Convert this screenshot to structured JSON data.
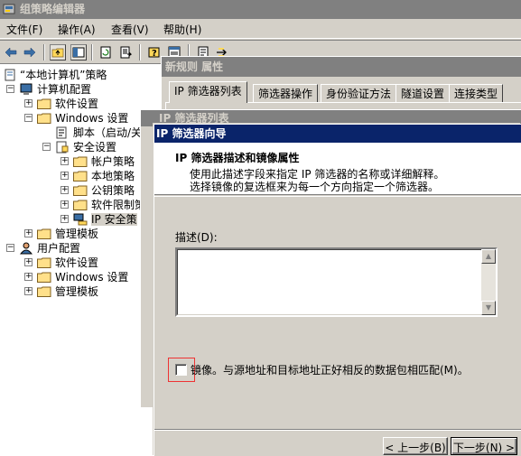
{
  "app": {
    "title": "组策略编辑器",
    "icon": "gpedit-icon"
  },
  "menu": {
    "items": [
      "文件(F)",
      "操作(A)",
      "查看(V)",
      "帮助(H)"
    ]
  },
  "toolbar": {
    "buttons": [
      "back-arrow-icon",
      "forward-arrow-icon",
      "up-folder-icon",
      "show-hide-tree-icon",
      "refresh-icon",
      "export-list-icon",
      "help-icon",
      "properties-icon",
      "details-icon",
      "action-icon"
    ]
  },
  "tree": {
    "root": "“本地计算机”策略",
    "items": [
      {
        "label": "计算机配置"
      },
      {
        "label": "软件设置"
      },
      {
        "label": "Windows 设置"
      },
      {
        "label": "脚本（启动/关"
      },
      {
        "label": "安全设置"
      },
      {
        "label": "帐户策略"
      },
      {
        "label": "本地策略"
      },
      {
        "label": "公钥策略"
      },
      {
        "label": "软件限制策"
      },
      {
        "label": "IP 安全策"
      },
      {
        "label": "管理模板"
      },
      {
        "label": "用户配置"
      },
      {
        "label": "软件设置"
      },
      {
        "label": "Windows 设置"
      },
      {
        "label": "管理模板"
      }
    ]
  },
  "props_dialog": {
    "title": "新规则 属性",
    "tabs": [
      "IP 筛选器列表",
      "筛选器操作",
      "身份验证方法",
      "隧道设置",
      "连接类型"
    ]
  },
  "filter_list": {
    "title": "IP 筛选器列表"
  },
  "wizard": {
    "title": "IP 筛选器向导",
    "heading": "IP 筛选器描述和镜像属性",
    "subtext1": "使用此描述字段来指定 IP 筛选器的名称或详细解释。",
    "subtext2": "选择镜像的复选框来为每一个方向指定一个筛选器。",
    "description_label": "描述(D):",
    "description_value": "",
    "mirror_label": "镜像。与源地址和目标地址正好相反的数据包相匹配(M)。",
    "mirror_checked": false,
    "back_button": "< 上一步(B)",
    "next_button": "下一步(N) >"
  },
  "colors": {
    "active_title": "#0a246a",
    "inactive_title": "#808080",
    "face": "#d4d0c8"
  }
}
